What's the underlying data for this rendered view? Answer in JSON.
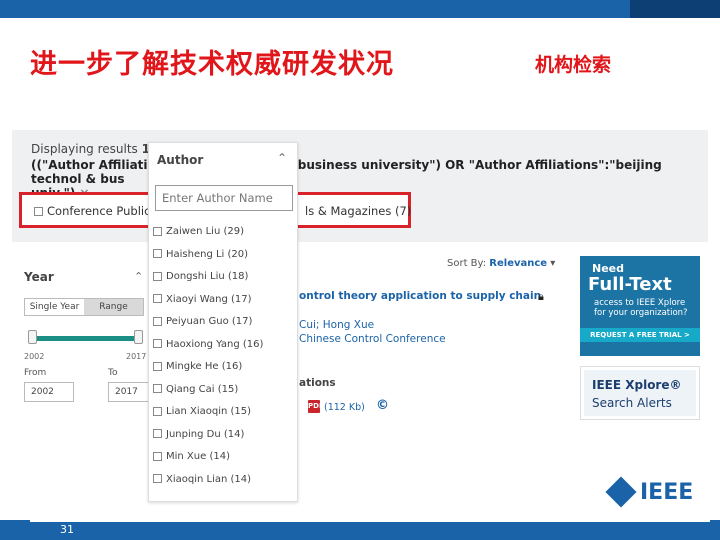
{
  "slide": {
    "title": "进一步了解技术权威研发状况",
    "subtitle": "机构检索",
    "page_number": "31"
  },
  "results": {
    "displaying_prefix": "Displaying results ",
    "displaying_range": "1-2",
    "query_left": "((\"Author Affiliatio",
    "query_right": "business university\") OR \"Author Affiliations\":\"beijing technol & bus",
    "query_tail": "univ.\")",
    "clear_icon": "×"
  },
  "refine": {
    "conference_label": "Conference Publica",
    "journals_label": "ls & Magazines (7)"
  },
  "year_filter": {
    "title": "Year",
    "tabs": [
      "Single Year",
      "Range"
    ],
    "min_year": "2002",
    "max_year": "2017",
    "from_label": "From",
    "to_label": "To",
    "from_value": "2002",
    "to_value": "2017"
  },
  "author_filter": {
    "title": "Author",
    "search_placeholder": "Enter Author Name",
    "authors": [
      {
        "label": "Zaiwen Liu (29)"
      },
      {
        "label": "Haisheng Li (20)"
      },
      {
        "label": "Dongshi Liu (18)"
      },
      {
        "label": "Xiaoyi Wang (17)"
      },
      {
        "label": "Peiyuan Guo (17)"
      },
      {
        "label": "Haoxiong Yang (16)"
      },
      {
        "label": "Mingke He (16)"
      },
      {
        "label": "Qiang Cai (15)"
      },
      {
        "label": "Lian Xiaoqin (15)"
      },
      {
        "label": "Junping Du (14)"
      },
      {
        "label": "Min Xue (14)"
      },
      {
        "label": "Xiaoqin Lian (14)"
      }
    ]
  },
  "listing": {
    "sort_label": "Sort By: ",
    "sort_value": "Relevance",
    "result_title": "ontrol theory application to supply chain",
    "result_authors": "Cui; Hong Xue",
    "result_conference": "Chinese Control Conference",
    "publications_label": "ations",
    "pdf_icon_text": "PDF",
    "pdf_size": "(112 Kb)",
    "copyright_icon": "©"
  },
  "ads": {
    "need": "Need",
    "full_text": "Full-Text",
    "access_line1": "access to IEEE Xplore",
    "access_line2": "for your organization?",
    "trial_button": "REQUEST A FREE TRIAL >",
    "alerts_brand": "IEEE Xplore®",
    "alerts_search": "Search Alerts"
  },
  "logo": {
    "text": "IEEE"
  },
  "colors": {
    "accent_red": "#e0161b",
    "brand_blue": "#1b63a8",
    "highlight_box": "#d8232a"
  }
}
